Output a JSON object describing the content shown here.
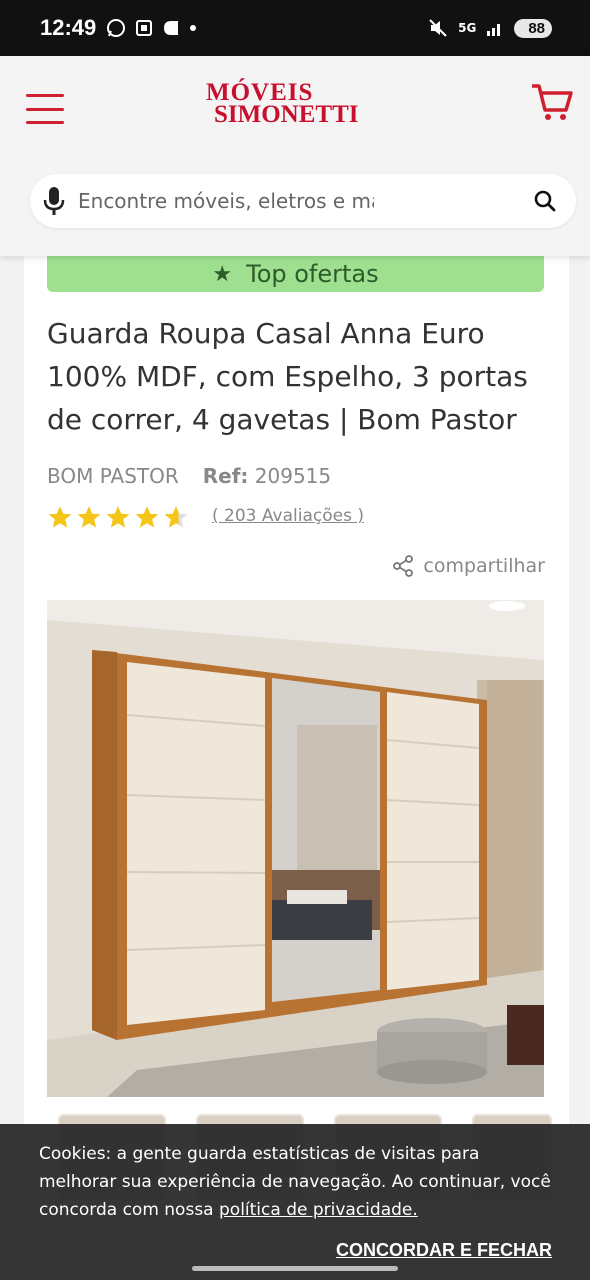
{
  "status_bar": {
    "time": "12:49",
    "battery": "88",
    "network": "5G"
  },
  "header": {
    "logo_line1": "MÓVEIS",
    "logo_line2": "SIMONETTI",
    "search_placeholder": "Encontre móveis, eletros e ma"
  },
  "product": {
    "badge": "Top ofertas",
    "title": "Guarda Roupa Casal Anna Euro 100% MDF, com Espelho, 3 portas de correr, 4 gavetas | Bom Pastor",
    "brand": "BOM PASTOR",
    "ref_label": "Ref:",
    "ref_value": "209515",
    "rating": 4.5,
    "reviews": "( 203 Avaliações )",
    "share_label": "compartilhar"
  },
  "cookie_banner": {
    "text": "Cookies: a gente guarda estatísticas de visitas para melhorar sua experiência de navegação. Ao continuar, você concorda com nossa",
    "link": "política de privacidade.",
    "button": "CONCORDAR E FECHAR"
  },
  "colors": {
    "brand": "#c8102e",
    "badge_bg": "#9ee08f",
    "star": "#f5c518"
  }
}
